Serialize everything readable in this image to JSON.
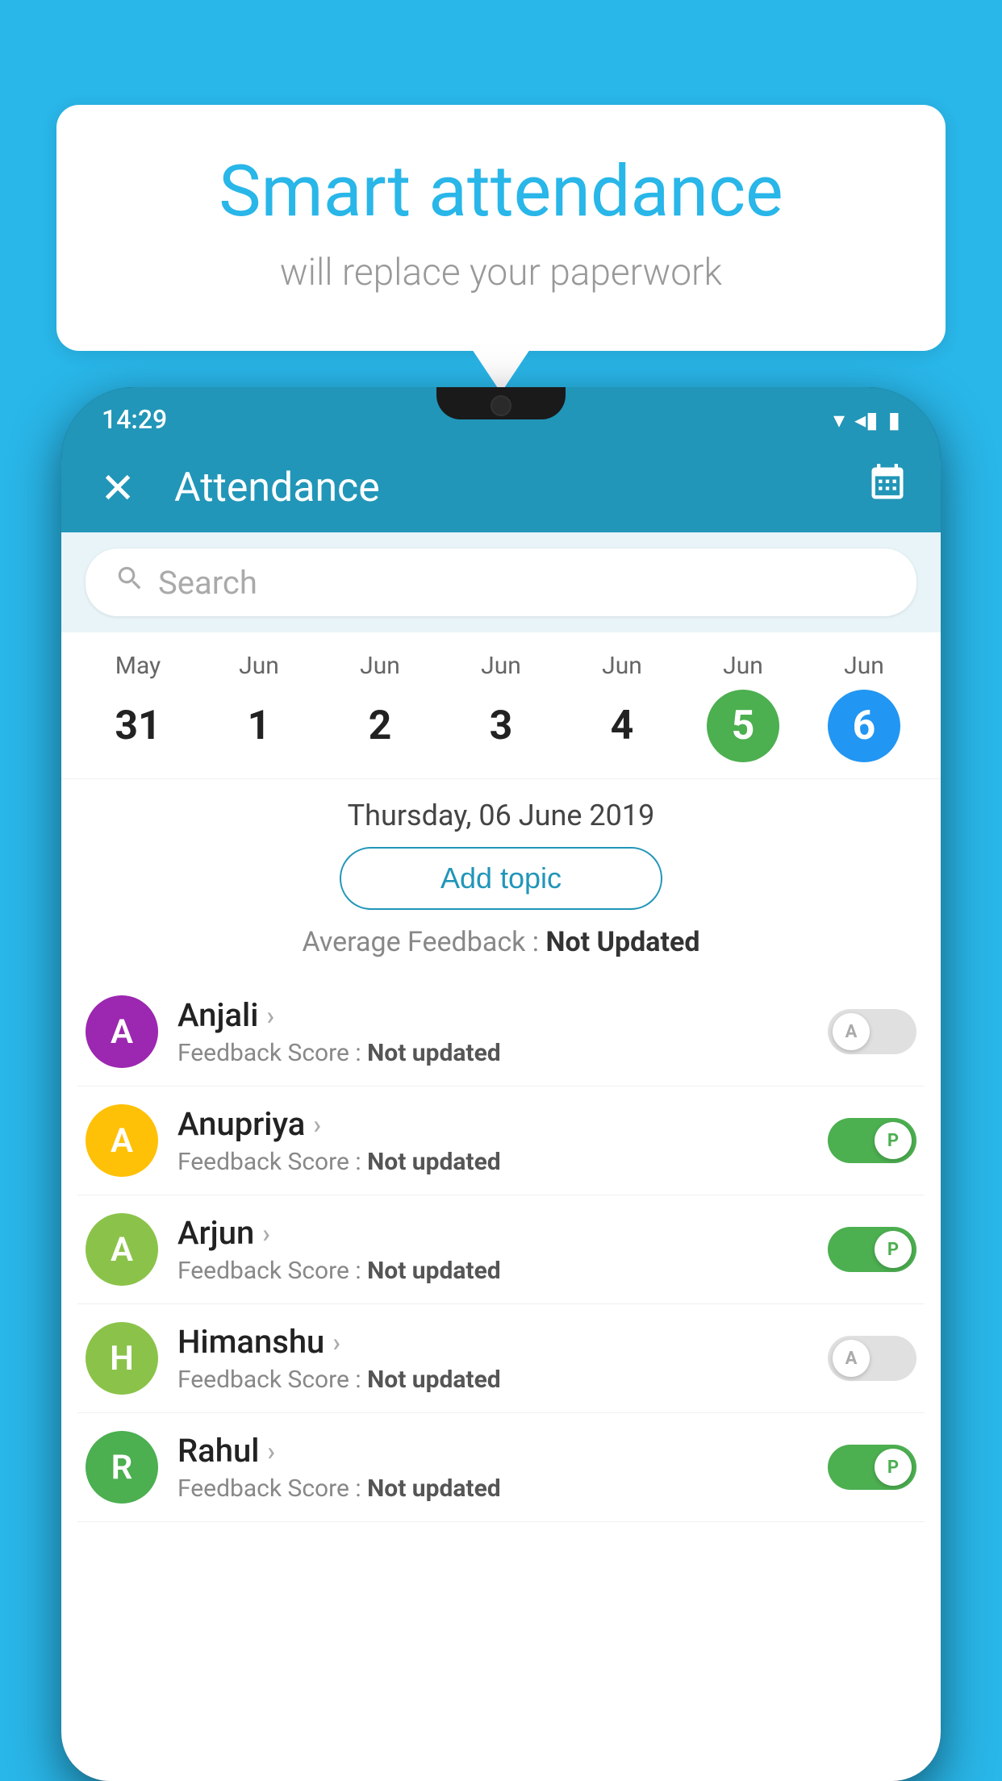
{
  "background_color": "#29b6e8",
  "bubble": {
    "title": "Smart attendance",
    "subtitle": "will replace your paperwork"
  },
  "status_bar": {
    "time": "14:29",
    "wifi_icon": "▼",
    "signal_icon": "◀",
    "battery_icon": "▮"
  },
  "app_bar": {
    "title": "Attendance",
    "close_icon": "✕",
    "calendar_icon": "📅"
  },
  "search": {
    "placeholder": "Search"
  },
  "calendar": {
    "days": [
      {
        "month": "May",
        "date": "31",
        "state": "normal"
      },
      {
        "month": "Jun",
        "date": "1",
        "state": "normal"
      },
      {
        "month": "Jun",
        "date": "2",
        "state": "normal"
      },
      {
        "month": "Jun",
        "date": "3",
        "state": "normal"
      },
      {
        "month": "Jun",
        "date": "4",
        "state": "normal"
      },
      {
        "month": "Jun",
        "date": "5",
        "state": "today"
      },
      {
        "month": "Jun",
        "date": "6",
        "state": "selected"
      }
    ]
  },
  "date_heading": "Thursday, 06 June 2019",
  "add_topic_label": "Add topic",
  "avg_feedback_label": "Average Feedback : ",
  "avg_feedback_value": "Not Updated",
  "students": [
    {
      "name": "Anjali",
      "initial": "A",
      "avatar_color": "#9c27b0",
      "score_label": "Feedback Score : ",
      "score_value": "Not updated",
      "toggle_state": "off",
      "toggle_letter": "A"
    },
    {
      "name": "Anupriya",
      "initial": "A",
      "avatar_color": "#ffc107",
      "score_label": "Feedback Score : ",
      "score_value": "Not updated",
      "toggle_state": "on",
      "toggle_letter": "P"
    },
    {
      "name": "Arjun",
      "initial": "A",
      "avatar_color": "#8bc34a",
      "score_label": "Feedback Score : ",
      "score_value": "Not updated",
      "toggle_state": "on",
      "toggle_letter": "P"
    },
    {
      "name": "Himanshu",
      "initial": "H",
      "avatar_color": "#8bc34a",
      "score_label": "Feedback Score : ",
      "score_value": "Not updated",
      "toggle_state": "off",
      "toggle_letter": "A"
    },
    {
      "name": "Rahul",
      "initial": "R",
      "avatar_color": "#4caf50",
      "score_label": "Feedback Score : ",
      "score_value": "Not updated",
      "toggle_state": "on",
      "toggle_letter": "P"
    }
  ]
}
